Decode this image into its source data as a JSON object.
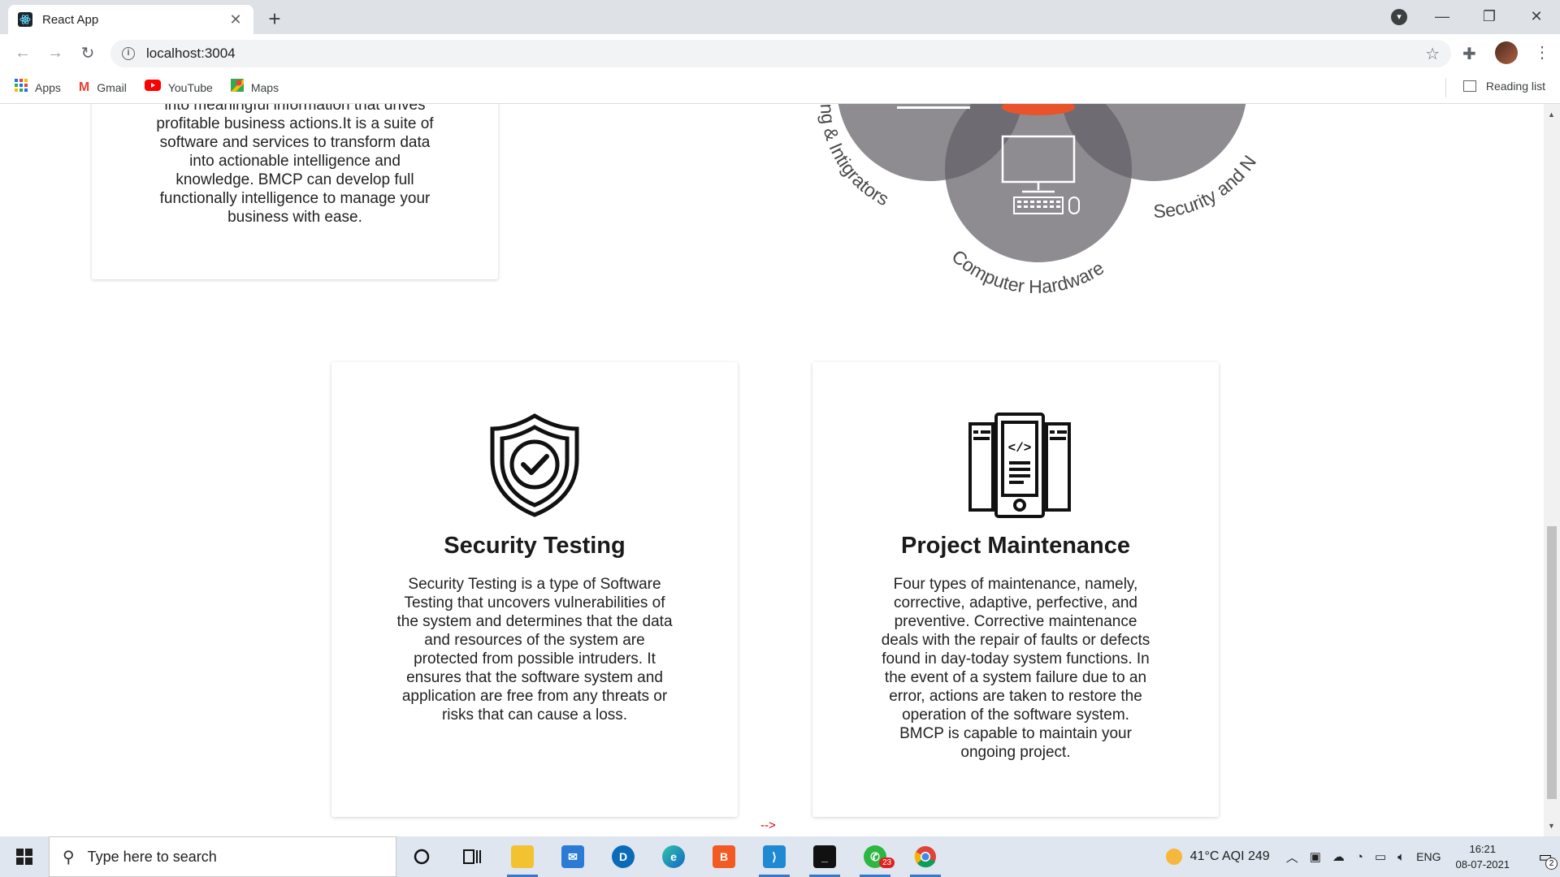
{
  "browser": {
    "tab_title": "React App",
    "url": "localhost:3004",
    "profile_initial": "",
    "bookmarks": [
      "Apps",
      "Gmail",
      "YouTube",
      "Maps"
    ],
    "reading_list": "Reading list"
  },
  "page": {
    "top_card_text": "into meaningful information that drives profitable business actions.It is a suite of software and services to transform data into actionable intelligence and knowledge. BMCP can develop full functionally intelligence to manage your business with ease.",
    "venn_labels": {
      "left": "ng & Intigrators",
      "bottom": "Computer Hardware",
      "right": "Security and N"
    },
    "cards": [
      {
        "title": "Security Testing",
        "body": "Security Testing is a type of Software Testing that uncovers vulnerabilities of the system and determines that the data and resources of the system are protected from possible intruders. It ensures that the software system and application are free from any threats or risks that can cause a loss.",
        "icon": "shield-check-icon"
      },
      {
        "title": "Project Maintenance",
        "body": "Four types of maintenance, namely, corrective, adaptive, perfective, and preventive. Corrective maintenance deals with the repair of faults or defects found in day-today system functions. In the event of a system failure due to an error, actions are taken to restore the operation of the software system. BMCP is capable to maintain your ongoing project.",
        "icon": "mobile-code-icon"
      }
    ],
    "stray_text": "-->"
  },
  "taskbar": {
    "search_placeholder": "Type here to search",
    "whatsapp_badge": "23",
    "weather": "41°C  AQI 249",
    "language": "ENG",
    "time": "16:21",
    "date": "08-07-2021",
    "notifications": "2"
  },
  "colors": {
    "venn_grey": "#8e8c91",
    "venn_overlap": "#6e6c72",
    "venn_accent": "#e8532b"
  }
}
